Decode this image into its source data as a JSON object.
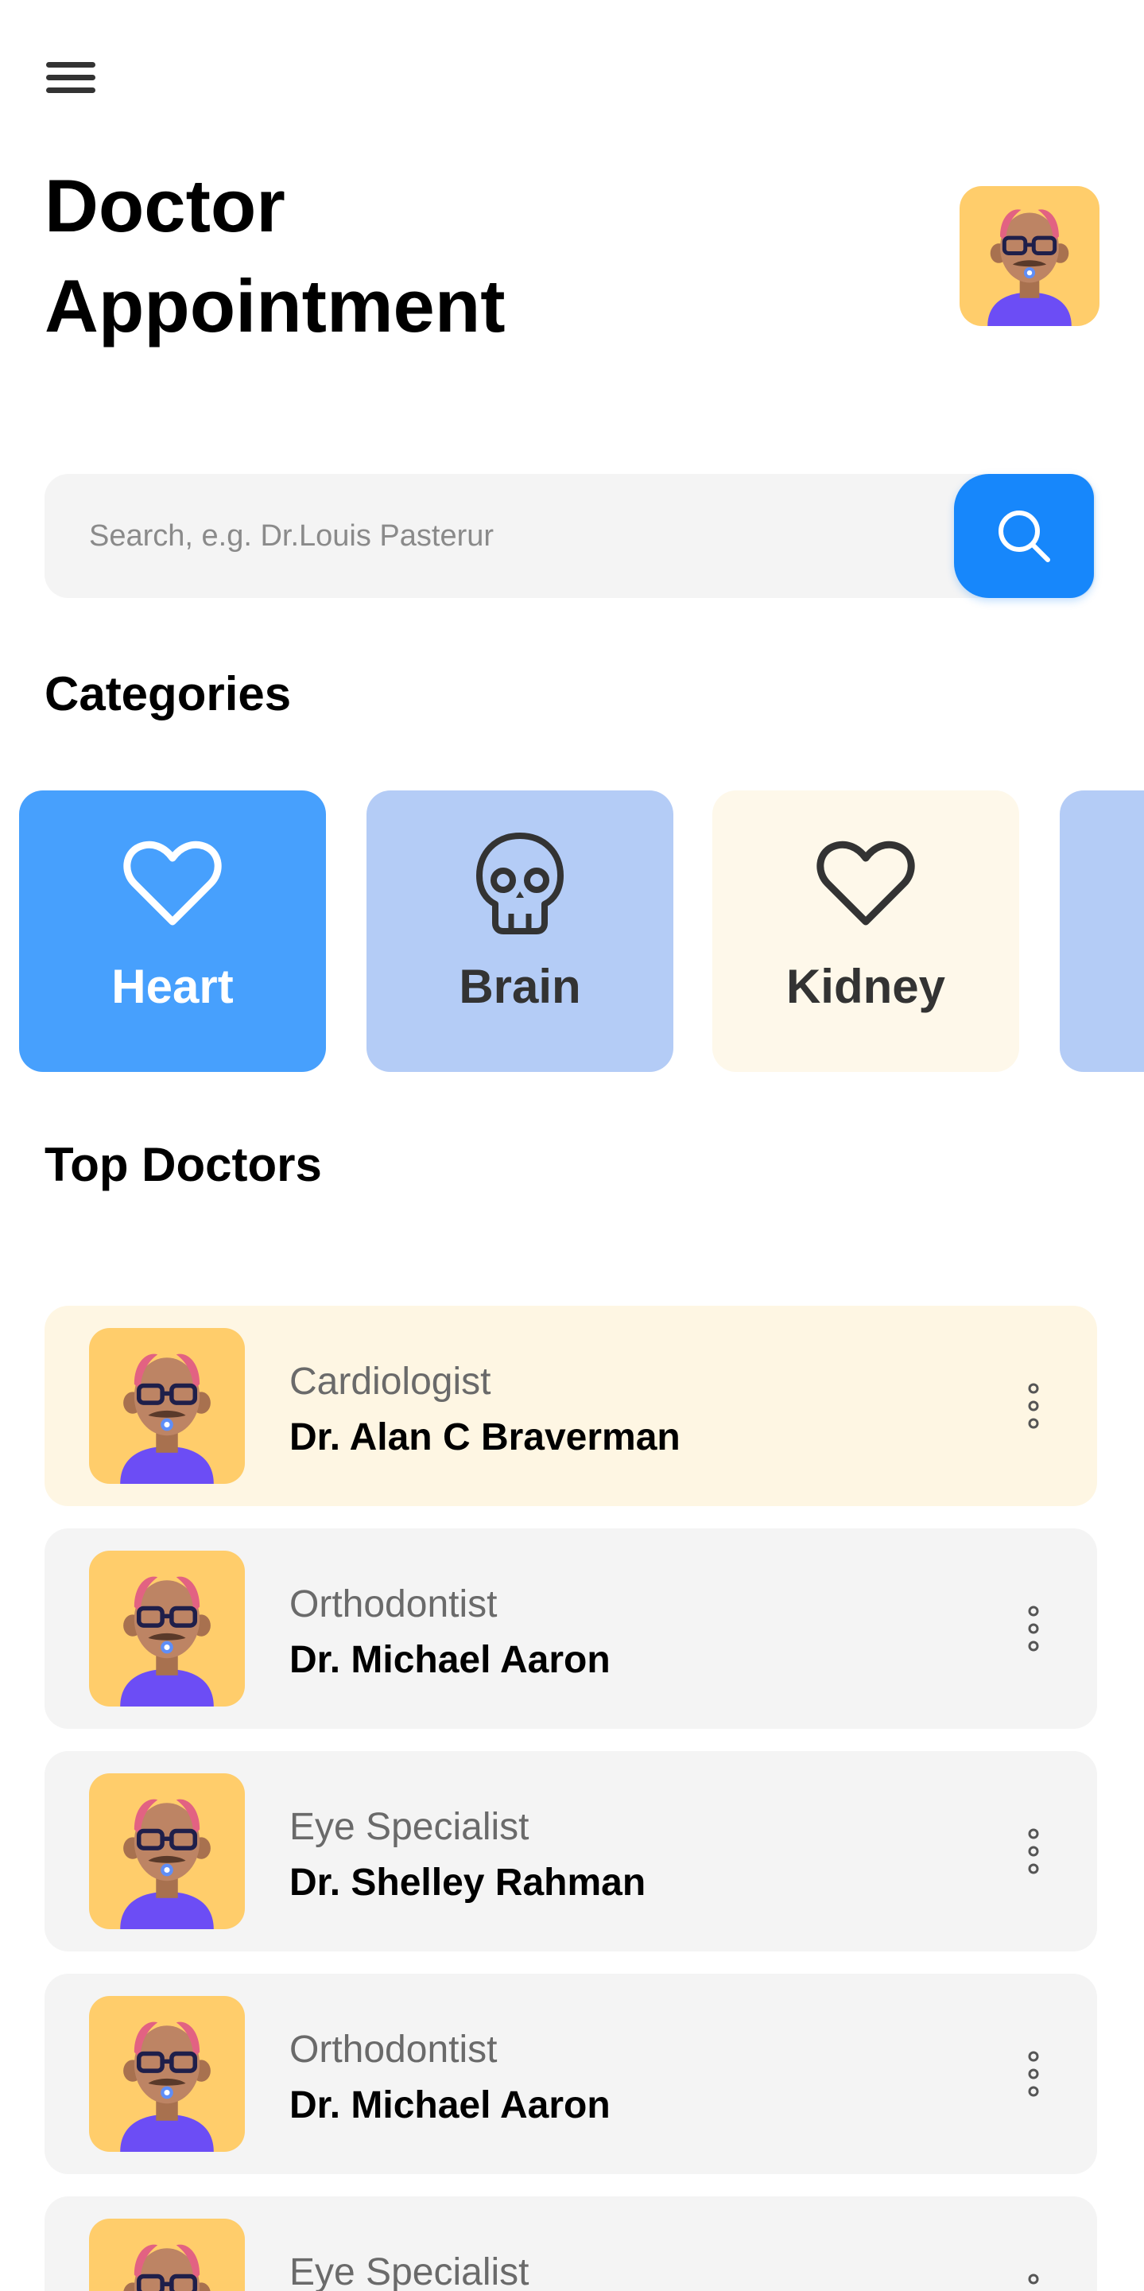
{
  "header": {
    "menu_icon": "hamburger-menu-icon",
    "title_line1": "Doctor",
    "title_line2": "Appointment",
    "avatar_icon": "doctor-avatar-icon"
  },
  "search": {
    "placeholder": "Search, e.g. Dr.Louis Pasterur",
    "value": "",
    "button_icon": "search-icon",
    "button_color": "#1787fb"
  },
  "categories": {
    "heading": "Categories",
    "items": [
      {
        "label": "Heart",
        "icon": "heart-icon",
        "background": "#47a0fd",
        "text_color": "#ffffff",
        "selected": true
      },
      {
        "label": "Brain",
        "icon": "skull-icon",
        "background": "#b4ccf6",
        "text_color": "#333333",
        "selected": false
      },
      {
        "label": "Kidney",
        "icon": "heart-icon",
        "background": "#fef8ea",
        "text_color": "#333333",
        "selected": false
      },
      {
        "label": "",
        "icon": "",
        "background": "#b4ccf6",
        "text_color": "#333333",
        "selected": false
      }
    ]
  },
  "top_doctors": {
    "heading": "Top Doctors",
    "items": [
      {
        "specialty": "Cardiologist",
        "name": "Dr. Alan C Braverman",
        "avatar_icon": "doctor-avatar-icon",
        "menu_icon": "more-vertical-icon",
        "highlighted": true
      },
      {
        "specialty": "Orthodontist",
        "name": "Dr. Michael Aaron",
        "avatar_icon": "doctor-avatar-icon",
        "menu_icon": "more-vertical-icon",
        "highlighted": false
      },
      {
        "specialty": "Eye Specialist",
        "name": "Dr. Shelley Rahman",
        "avatar_icon": "doctor-avatar-icon",
        "menu_icon": "more-vertical-icon",
        "highlighted": false
      },
      {
        "specialty": "Orthodontist",
        "name": "Dr. Michael Aaron",
        "avatar_icon": "doctor-avatar-icon",
        "menu_icon": "more-vertical-icon",
        "highlighted": false
      },
      {
        "specialty": "Eye Specialist",
        "name": "",
        "avatar_icon": "doctor-avatar-icon",
        "menu_icon": "more-vertical-icon",
        "highlighted": false
      }
    ]
  },
  "colors": {
    "card_gray": "#f4f4f4",
    "card_highlight": "#fef6e3",
    "avatar_background": "#ffcd6b",
    "secondary_text": "#6a6a6a"
  }
}
